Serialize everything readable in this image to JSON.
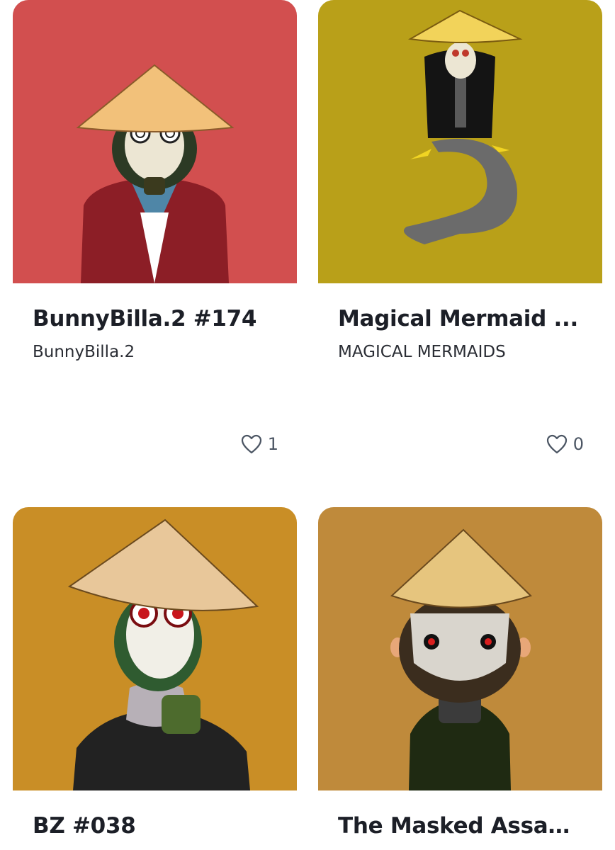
{
  "cards": [
    {
      "title": "BunnyBilla.2 #174",
      "collection": "BunnyBilla.2",
      "likes": "1",
      "image_icon": "masked-figure-red-jacket",
      "bg_color": "#d24f4f"
    },
    {
      "title": "Magical Mermaid ...",
      "collection": "MAGICAL MERMAIDS",
      "likes": "0",
      "image_icon": "masked-mermaid",
      "bg_color": "#b9a019"
    },
    {
      "title": "BZ #038",
      "collection": "",
      "likes": "",
      "image_icon": "masked-figure-hypno-eyes",
      "bg_color": "#c98e26"
    },
    {
      "title": "The Masked Assas...",
      "collection": "",
      "likes": "",
      "image_icon": "masked-assassin",
      "bg_color": "#bf8a3b"
    }
  ],
  "like_icon": "heart-outline-icon"
}
